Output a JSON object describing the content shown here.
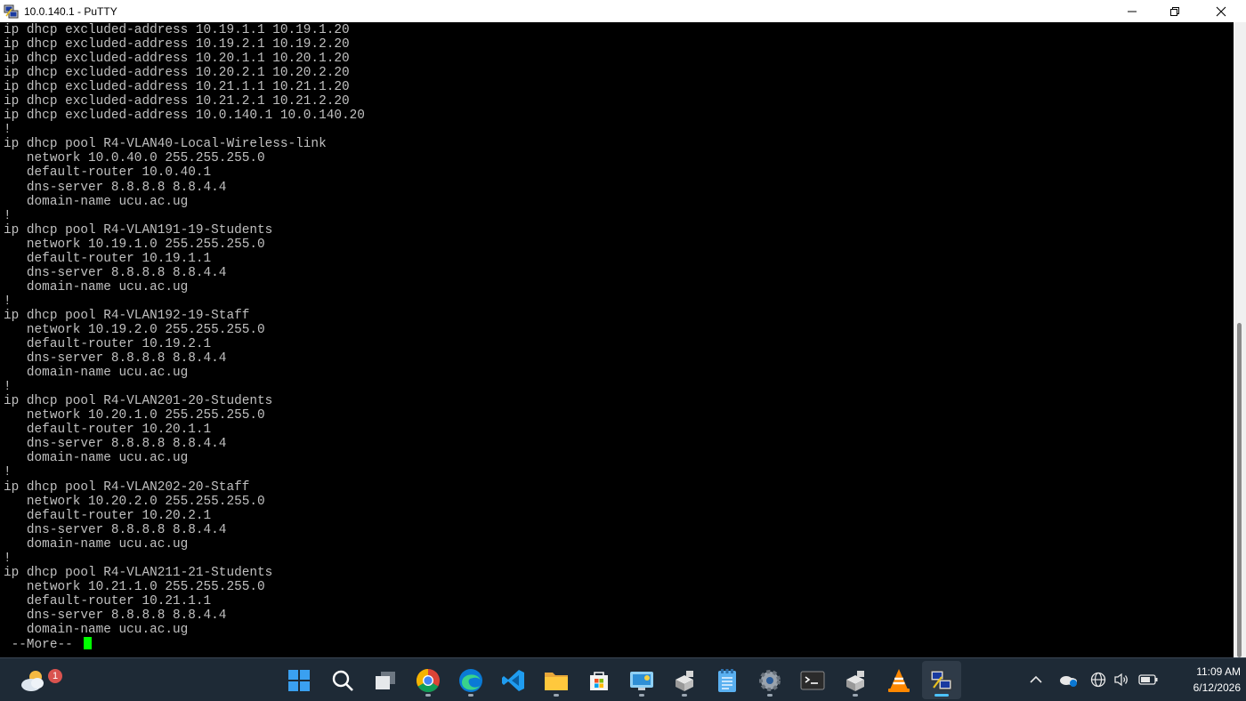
{
  "window": {
    "title": "10.0.140.1 - PuTTY"
  },
  "terminal": {
    "lines": [
      "ip dhcp excluded-address 10.19.1.1 10.19.1.20",
      "ip dhcp excluded-address 10.19.2.1 10.19.2.20",
      "ip dhcp excluded-address 10.20.1.1 10.20.1.20",
      "ip dhcp excluded-address 10.20.2.1 10.20.2.20",
      "ip dhcp excluded-address 10.21.1.1 10.21.1.20",
      "ip dhcp excluded-address 10.21.2.1 10.21.2.20",
      "ip dhcp excluded-address 10.0.140.1 10.0.140.20",
      "!",
      "ip dhcp pool R4-VLAN40-Local-Wireless-link",
      "   network 10.0.40.0 255.255.255.0",
      "   default-router 10.0.40.1",
      "   dns-server 8.8.8.8 8.8.4.4",
      "   domain-name ucu.ac.ug",
      "!",
      "ip dhcp pool R4-VLAN191-19-Students",
      "   network 10.19.1.0 255.255.255.0",
      "   default-router 10.19.1.1",
      "   dns-server 8.8.8.8 8.8.4.4",
      "   domain-name ucu.ac.ug",
      "!",
      "ip dhcp pool R4-VLAN192-19-Staff",
      "   network 10.19.2.0 255.255.255.0",
      "   default-router 10.19.2.1",
      "   dns-server 8.8.8.8 8.8.4.4",
      "   domain-name ucu.ac.ug",
      "!",
      "ip dhcp pool R4-VLAN201-20-Students",
      "   network 10.20.1.0 255.255.255.0",
      "   default-router 10.20.1.1",
      "   dns-server 8.8.8.8 8.8.4.4",
      "   domain-name ucu.ac.ug",
      "!",
      "ip dhcp pool R4-VLAN202-20-Staff",
      "   network 10.20.2.0 255.255.255.0",
      "   default-router 10.20.2.1",
      "   dns-server 8.8.8.8 8.8.4.4",
      "   domain-name ucu.ac.ug",
      "!",
      "ip dhcp pool R4-VLAN211-21-Students",
      "   network 10.21.1.0 255.255.255.0",
      "   default-router 10.21.1.1",
      "   dns-server 8.8.8.8 8.8.4.4",
      "   domain-name ucu.ac.ug"
    ],
    "more_prompt": " --More-- ",
    "text_color": "#c0c0c0",
    "cursor_color": "#00ff00"
  },
  "taskbar": {
    "notification_badge": "1",
    "apps": [
      "start-icon",
      "search-icon",
      "task-view-icon",
      "chrome-icon",
      "edge-icon",
      "vscode-icon",
      "file-explorer-icon",
      "microsoft-store-icon",
      "remote-desktop-icon",
      "network-tool-icon",
      "notepad-icon",
      "settings-gear-icon",
      "terminal-icon",
      "network-tool-icon",
      "vlc-icon",
      "putty-icon"
    ],
    "tray_icons": [
      "chevron-up-icon",
      "onedrive-icon",
      "network-globe-icon",
      "speaker-icon",
      "battery-icon"
    ],
    "clock": {
      "time": "11:09 AM",
      "date": "6/12/2026"
    }
  }
}
